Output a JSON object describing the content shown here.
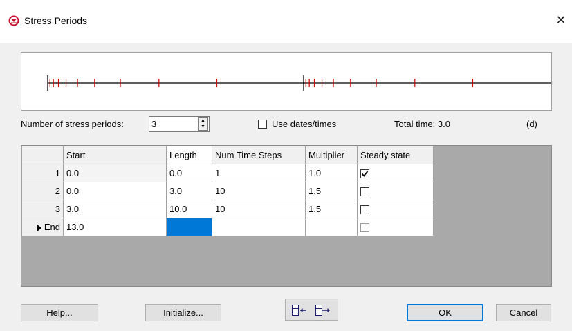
{
  "window": {
    "title": "Stress Periods",
    "close_glyph": "✕"
  },
  "controls": {
    "num_periods_label": "Number of stress periods:",
    "num_periods_value": "3",
    "use_dates_label": "Use dates/times",
    "use_dates_checked": false,
    "total_time_label": "Total time: 3.0",
    "units_label": "(d)"
  },
  "timeline": {
    "axis_color": "#000000",
    "tick_color": "#cc0000",
    "period_bounds": [
      0.0,
      3.0,
      13.0
    ],
    "time_steps": [
      [],
      [
        10,
        1.5
      ],
      [
        10,
        1.5
      ]
    ]
  },
  "grid": {
    "columns": [
      "Start",
      "Length",
      "Num Time Steps",
      "Multiplier",
      "Steady state"
    ],
    "rows": [
      {
        "header": "1",
        "start": "0.0",
        "length": "0.0",
        "steps": "1",
        "multiplier": "1.0",
        "steady": true
      },
      {
        "header": "2",
        "start": "0.0",
        "length": "3.0",
        "steps": "10",
        "multiplier": "1.5",
        "steady": false
      },
      {
        "header": "3",
        "start": "3.0",
        "length": "10.0",
        "steps": "10",
        "multiplier": "1.5",
        "steady": false
      },
      {
        "header": "End",
        "start": "13.0",
        "length": "",
        "steps": "",
        "multiplier": "",
        "steady": false
      }
    ],
    "selection_color": "#0078d7"
  },
  "buttons": {
    "help": "Help...",
    "initialize": "Initialize...",
    "ok": "OK",
    "cancel": "Cancel",
    "insert_icon": "insert-row-icon",
    "delete_icon": "delete-row-icon"
  }
}
